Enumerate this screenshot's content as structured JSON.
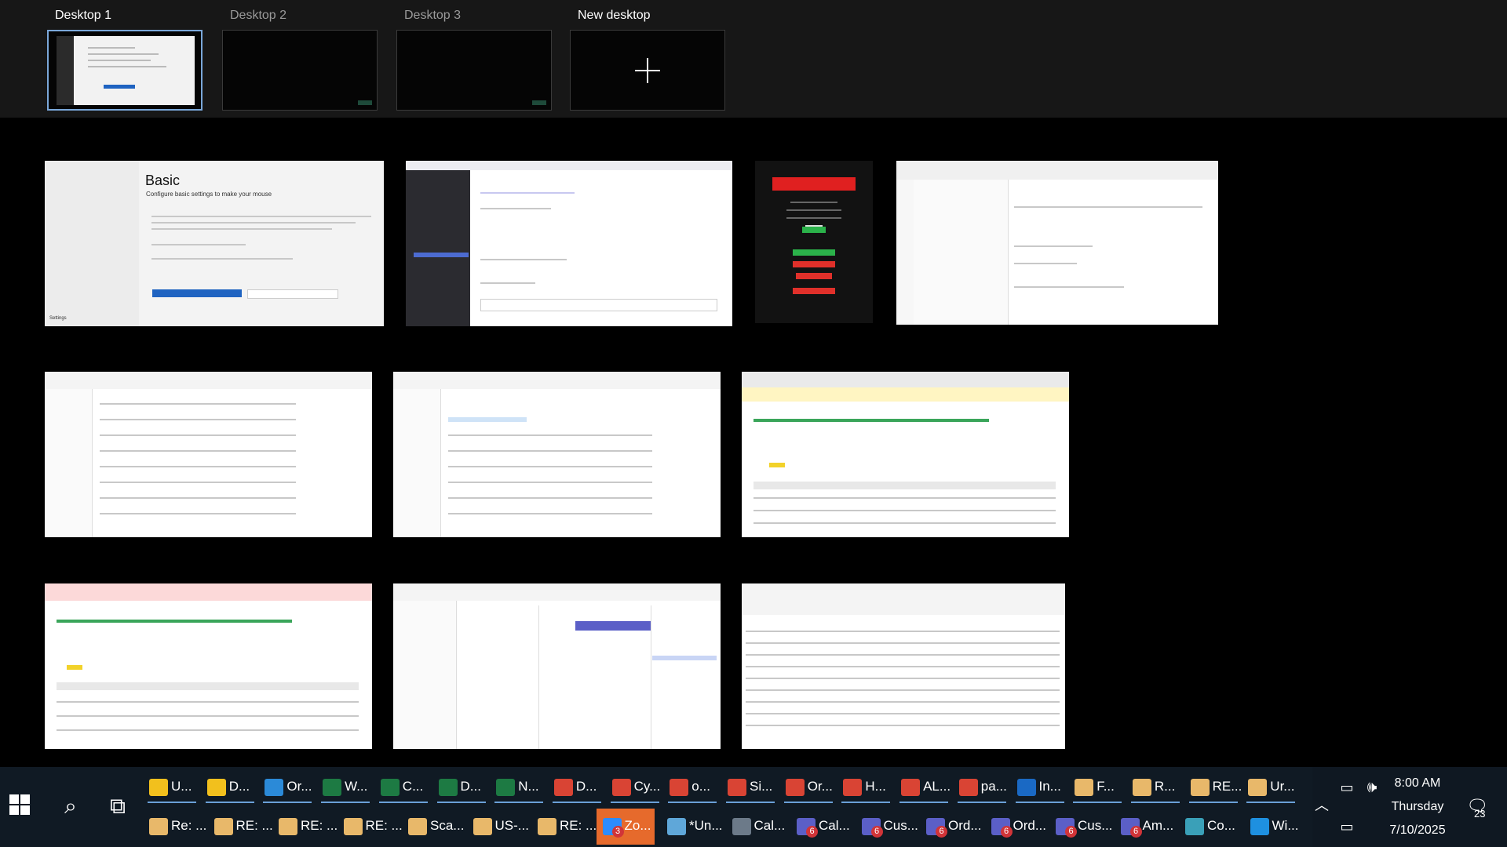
{
  "desktops": [
    {
      "label": "Desktop 1",
      "selected": true
    },
    {
      "label": "Desktop 2",
      "selected": false
    },
    {
      "label": "Desktop 3",
      "selected": false
    },
    {
      "label": "New desktop",
      "selected": false
    }
  ],
  "windows": {
    "basic": {
      "title": "Basic",
      "subtitle": "Configure basic settings to make your mouse",
      "footer": "Settings"
    }
  },
  "taskbar": {
    "row1": [
      {
        "label": "U...",
        "icon": "folder-icon",
        "color": "#f2c01d"
      },
      {
        "label": "D...",
        "icon": "folder-icon",
        "color": "#f2c01d"
      },
      {
        "label": "Or...",
        "icon": "edge-icon",
        "color": "#2b8ad8"
      },
      {
        "label": "W...",
        "icon": "excel-icon",
        "color": "#1d7a43"
      },
      {
        "label": "C...",
        "icon": "excel-icon",
        "color": "#1d7a43"
      },
      {
        "label": "D...",
        "icon": "excel-icon",
        "color": "#1d7a43"
      },
      {
        "label": "N...",
        "icon": "excel-icon",
        "color": "#1d7a43"
      },
      {
        "label": "D...",
        "icon": "chrome-icon",
        "color": "#d94434"
      },
      {
        "label": "Cy...",
        "icon": "chrome-icon",
        "color": "#d94434"
      },
      {
        "label": "o...",
        "icon": "chrome-icon",
        "color": "#d94434"
      },
      {
        "label": "Si...",
        "icon": "chrome-icon",
        "color": "#d94434"
      },
      {
        "label": "Or...",
        "icon": "chrome-icon",
        "color": "#d94434"
      },
      {
        "label": "H...",
        "icon": "chrome-icon",
        "color": "#d94434"
      },
      {
        "label": "AL...",
        "icon": "chrome-icon",
        "color": "#d94434"
      },
      {
        "label": "pa...",
        "icon": "chrome-icon",
        "color": "#d94434"
      },
      {
        "label": "In...",
        "icon": "outlook-icon",
        "color": "#1a69c4"
      },
      {
        "label": "F...",
        "icon": "mail-icon",
        "color": "#e8b86a"
      },
      {
        "label": "R...",
        "icon": "mail-icon",
        "color": "#e8b86a"
      },
      {
        "label": "RE...",
        "icon": "mail-icon",
        "color": "#e8b86a"
      },
      {
        "label": "Ur...",
        "icon": "mail-icon",
        "color": "#e8b86a"
      }
    ],
    "row2": [
      {
        "label": "Re: ...",
        "icon": "mail-icon",
        "color": "#e8b86a"
      },
      {
        "label": "RE: ...",
        "icon": "mail-icon",
        "color": "#e8b86a"
      },
      {
        "label": "RE: ...",
        "icon": "mail-icon",
        "color": "#e8b86a"
      },
      {
        "label": "RE: ...",
        "icon": "mail-icon",
        "color": "#e8b86a"
      },
      {
        "label": "Sca...",
        "icon": "mail-icon",
        "color": "#e8b86a"
      },
      {
        "label": "US-...",
        "icon": "mail-icon",
        "color": "#e8b86a"
      },
      {
        "label": "RE: ...",
        "icon": "mail-icon",
        "color": "#e8b86a"
      },
      {
        "label": "Zo...",
        "icon": "zoom-icon",
        "color": "#2d8cff",
        "badge": "3",
        "active": true
      },
      {
        "label": "*Un...",
        "icon": "notepad-icon",
        "color": "#5fa7d9"
      },
      {
        "label": "Cal...",
        "icon": "calculator-icon",
        "color": "#6c7a89"
      },
      {
        "label": "Cal...",
        "icon": "teams-icon",
        "color": "#5b5fc7",
        "badge": "6"
      },
      {
        "label": "Cus...",
        "icon": "teams-icon",
        "color": "#5b5fc7",
        "badge": "6"
      },
      {
        "label": "Ord...",
        "icon": "teams-icon",
        "color": "#5b5fc7",
        "badge": "6"
      },
      {
        "label": "Ord...",
        "icon": "teams-icon",
        "color": "#5b5fc7",
        "badge": "6"
      },
      {
        "label": "Cus...",
        "icon": "teams-icon",
        "color": "#5b5fc7",
        "badge": "6"
      },
      {
        "label": "Am...",
        "icon": "teams-icon",
        "color": "#5b5fc7",
        "badge": "6"
      },
      {
        "label": "Co...",
        "icon": "app-icon",
        "color": "#3aa0b8"
      },
      {
        "label": "Wi...",
        "icon": "app-icon",
        "color": "#1e90e0"
      }
    ]
  },
  "tray": {
    "time": "8:00 AM",
    "day": "Thursday",
    "date": "7/10/2025",
    "notifications": "23"
  }
}
